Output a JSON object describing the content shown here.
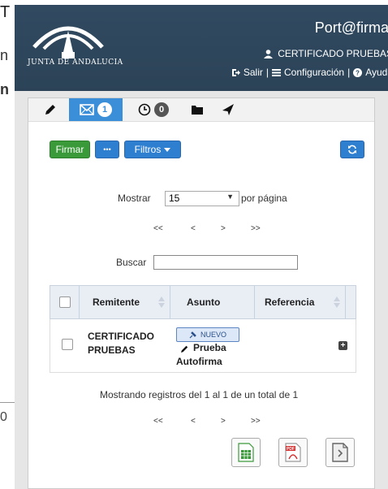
{
  "edge": {
    "t": "T",
    "n": "n",
    "n2": "n",
    "zero": "0"
  },
  "header": {
    "logo_text": "JUNTA DE ANDALUCIA",
    "brand": "Port@firmas",
    "user_name": "CERTIFICADO PRUEBAS",
    "links": {
      "salir": "Salir",
      "configuracion": "Configuración",
      "ayuda": "Ayuda"
    }
  },
  "tabs": [
    {
      "icon": "pencil-icon"
    },
    {
      "icon": "envelope-icon",
      "count": "1"
    },
    {
      "icon": "clock-icon",
      "count": "0"
    },
    {
      "icon": "folder-icon"
    },
    {
      "icon": "send-icon"
    }
  ],
  "toolbar": {
    "firmar": "Firmar",
    "more": "•••",
    "filtros": "Filtros"
  },
  "paging": {
    "mostrar": "Mostrar",
    "page_size": "15",
    "por_pagina": "por página",
    "first": "<<",
    "prev": "<",
    "next": ">",
    "last": ">>"
  },
  "search": {
    "label": "Buscar",
    "value": ""
  },
  "table": {
    "headers": {
      "remitente": "Remitente",
      "asunto": "Asunto",
      "referencia": "Referencia"
    },
    "rows": [
      {
        "remitente_1": "CERTIFICADO",
        "remitente_2": "PRUEBAS",
        "tag": "NUEVO",
        "asunto_1": "Prueba",
        "asunto_2": "Autofirma",
        "referencia": ""
      }
    ]
  },
  "footer": {
    "summary": "Mostrando registros del 1 al 1 de un total de 1"
  },
  "colors": {
    "header": "#2f4a60",
    "accent": "#3b8fd9",
    "green": "#3a9a3a"
  }
}
